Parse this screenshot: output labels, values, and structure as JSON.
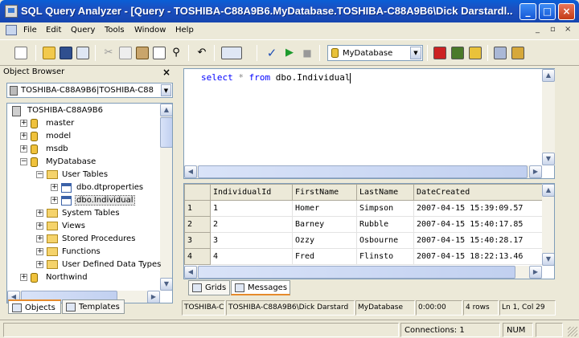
{
  "window": {
    "title": "SQL Query Analyzer - [Query - TOSHIBA-C88A9B6.MyDatabase.TOSHIBA-C88A9B6\\Dick Darstardl...",
    "minimize": "_",
    "maximize": "□",
    "close": "×"
  },
  "menu": {
    "items": [
      "File",
      "Edit",
      "Query",
      "Tools",
      "Window",
      "Help"
    ],
    "mdi_controls": [
      "_",
      "▫",
      "×"
    ]
  },
  "toolbar": {
    "database": "MyDatabase",
    "icons": [
      "new-query-icon",
      "open-icon",
      "save-icon",
      "load-script-icon",
      "cut-icon",
      "copy-icon",
      "paste-icon",
      "clear-window-icon",
      "find-icon",
      "undo-icon",
      "results-mode-icon",
      "parse-icon",
      "execute-icon",
      "cancel-icon",
      "object-browser-icon",
      "object-search-icon",
      "show-plan-icon",
      "options-icon",
      "properties-icon"
    ]
  },
  "object_browser": {
    "header": "Object Browser",
    "close": "×",
    "server_combo": "TOSHIBA-C88A9B6|TOSHIBA-C88",
    "tree": [
      {
        "label": "TOSHIBA-C88A9B6",
        "kind": "server",
        "level": 0,
        "expander": ""
      },
      {
        "label": "master",
        "kind": "db",
        "level": 1,
        "expander": "+"
      },
      {
        "label": "model",
        "kind": "db",
        "level": 1,
        "expander": "+"
      },
      {
        "label": "msdb",
        "kind": "db",
        "level": 1,
        "expander": "+"
      },
      {
        "label": "MyDatabase",
        "kind": "db",
        "level": 1,
        "expander": "−"
      },
      {
        "label": "User Tables",
        "kind": "folder",
        "level": 2,
        "expander": "−"
      },
      {
        "label": "dbo.dtproperties",
        "kind": "table",
        "level": 3,
        "expander": "+"
      },
      {
        "label": "dbo.Individual",
        "kind": "table",
        "level": 3,
        "expander": "+",
        "selected": true
      },
      {
        "label": "System Tables",
        "kind": "folder",
        "level": 2,
        "expander": "+"
      },
      {
        "label": "Views",
        "kind": "folder",
        "level": 2,
        "expander": "+"
      },
      {
        "label": "Stored Procedures",
        "kind": "folder",
        "level": 2,
        "expander": "+"
      },
      {
        "label": "Functions",
        "kind": "folder",
        "level": 2,
        "expander": "+"
      },
      {
        "label": "User Defined Data Types",
        "kind": "folder",
        "level": 2,
        "expander": "+"
      },
      {
        "label": "Northwind",
        "kind": "db",
        "level": 1,
        "expander": "+"
      }
    ],
    "tabs": [
      "Objects",
      "Templates"
    ]
  },
  "editor": {
    "tokens": [
      {
        "text": "select",
        "cls": "kw"
      },
      {
        "text": " ",
        "cls": ""
      },
      {
        "text": "*",
        "cls": "op"
      },
      {
        "text": " ",
        "cls": ""
      },
      {
        "text": "from",
        "cls": "kw"
      },
      {
        "text": " dbo.Individual",
        "cls": ""
      }
    ]
  },
  "results": {
    "columns": [
      "IndividualId",
      "FirstName",
      "LastName",
      "DateCreated"
    ],
    "rows": [
      {
        "num": "1",
        "cells": [
          "1",
          "Homer",
          "Simpson",
          "2007-04-15 15:39:09.57"
        ]
      },
      {
        "num": "2",
        "cells": [
          "2",
          "Barney",
          "Rubble",
          "2007-04-15 15:40:17.85"
        ]
      },
      {
        "num": "3",
        "cells": [
          "3",
          "Ozzy",
          "Osbourne",
          "2007-04-15 15:40:28.17"
        ]
      },
      {
        "num": "4",
        "cells": [
          "4",
          "Fred",
          "Flinsto",
          "2007-04-15 18:22:13.46"
        ]
      }
    ],
    "tabs": [
      "Grids",
      "Messages"
    ]
  },
  "query_status": [
    "TOSHIBA-C",
    "TOSHIBA-C88A9B6\\Dick Darstard",
    "MyDatabase",
    "0:00:00",
    "4 rows",
    "Ln 1, Col 29"
  ],
  "status": {
    "connections": "Connections: 1",
    "num": "NUM"
  },
  "colors": {
    "titlebar": "#0a5fd6",
    "keyword": "#0000ff",
    "face": "#ece9d8"
  }
}
